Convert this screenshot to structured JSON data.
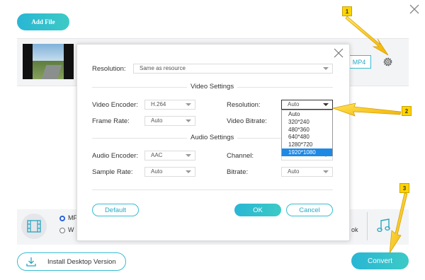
{
  "toolbar": {
    "add_file_label": "Add File"
  },
  "file": {
    "format_label": "MP4"
  },
  "settings": {
    "resolution_label": "Resolution:",
    "resolution_value": "Same as resource",
    "video_section": "Video Settings",
    "video_encoder_label": "Video Encoder:",
    "video_encoder_value": "H.264",
    "frame_rate_label": "Frame Rate:",
    "frame_rate_value": "Auto",
    "video_resolution_label": "Resolution:",
    "video_resolution_value": "Auto",
    "video_bitrate_label": "Video Bitrate:",
    "resolution_options": [
      "Auto",
      "320*240",
      "480*360",
      "640*480",
      "1280*720",
      "1920*1080"
    ],
    "resolution_highlighted": "1920*1080",
    "audio_section": "Audio Settings",
    "audio_encoder_label": "Audio Encoder:",
    "audio_encoder_value": "AAC",
    "channel_label": "Channel:",
    "sample_rate_label": "Sample Rate:",
    "sample_rate_value": "Auto",
    "bitrate_label": "Bitrate:",
    "bitrate_value": "Auto",
    "default_label": "Default",
    "ok_label": "OK",
    "cancel_label": "Cancel"
  },
  "output": {
    "option1_partial": "MF",
    "option2_partial": "W",
    "right_partial": "ok"
  },
  "footer": {
    "install_label": "Install Desktop Version",
    "convert_label": "Convert"
  },
  "annotations": {
    "badge1": "1",
    "badge2": "2",
    "badge3": "3"
  },
  "colors": {
    "accent": "#38bcd1",
    "highlight": "#1e88e5",
    "callout": "#ffd400"
  }
}
